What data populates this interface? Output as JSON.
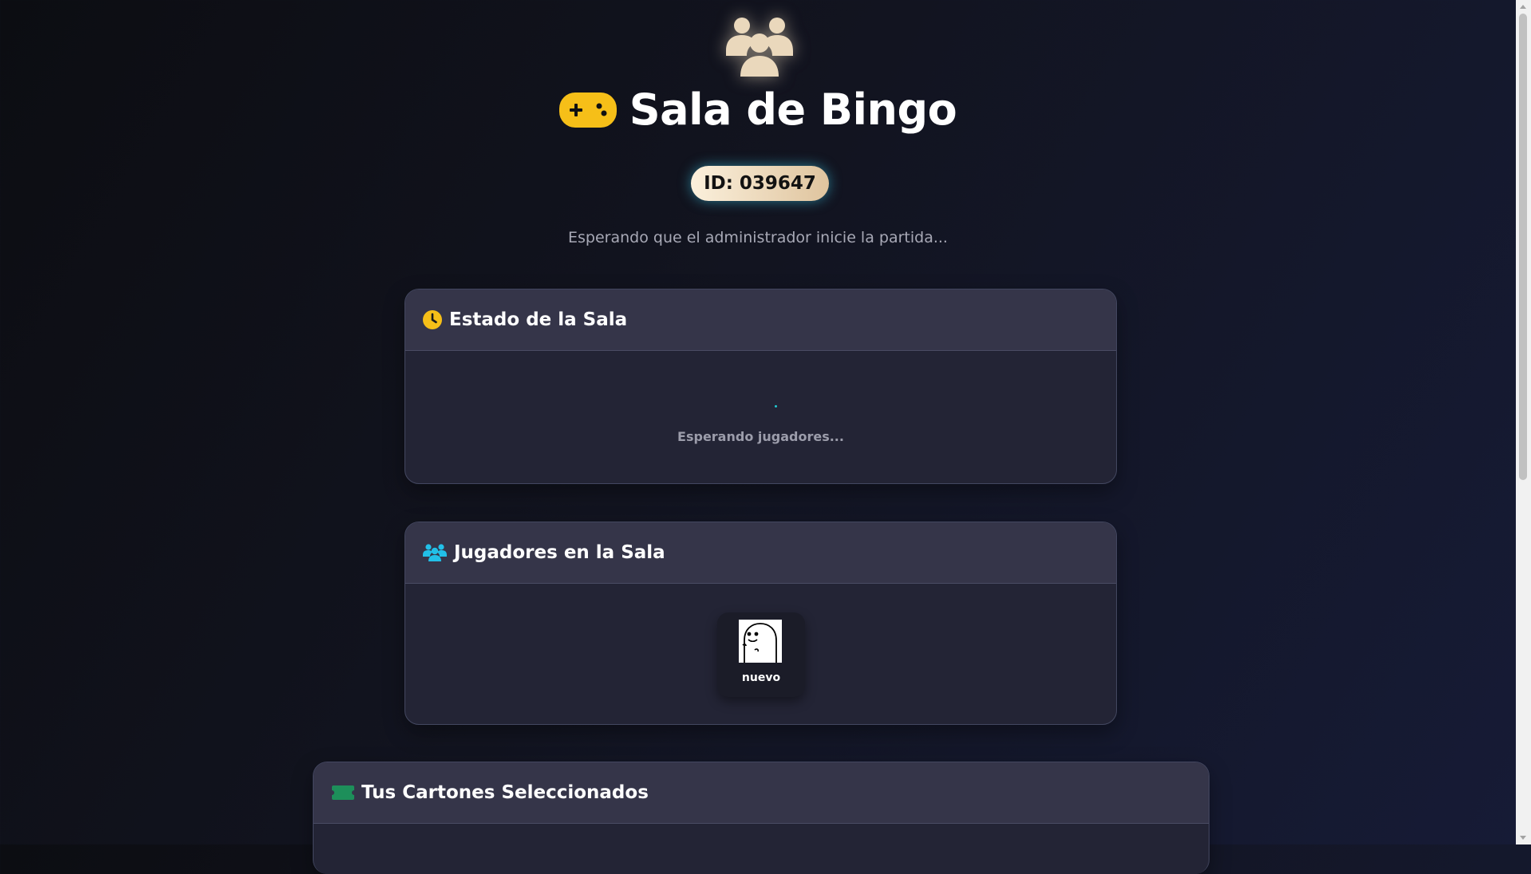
{
  "header": {
    "hero_icon": "users-icon",
    "title_icon": "gamepad-icon",
    "title": "Sala de Bingo",
    "room_id": "ID: 039647",
    "subtitle": "Esperando que el administrador inicie la partida..."
  },
  "status_card": {
    "icon": "clock-icon",
    "title": "Estado de la Sala",
    "status_text": "Esperando jugadores..."
  },
  "players_card": {
    "icon": "users-icon",
    "title": "Jugadores en la Sala",
    "players": [
      {
        "name": "nuevo",
        "avatar": "avatar-image"
      }
    ]
  },
  "tickets_card": {
    "icon": "ticket-icon",
    "title": "Tus Cartones Seleccionados"
  },
  "colors": {
    "accent_gold": "#f6bf18",
    "accent_cyan": "#22c0e8",
    "accent_green": "#1d8f5a",
    "hero_icon": "#ead8bc",
    "card_bg": "#232435",
    "card_header_bg": "#353549"
  }
}
